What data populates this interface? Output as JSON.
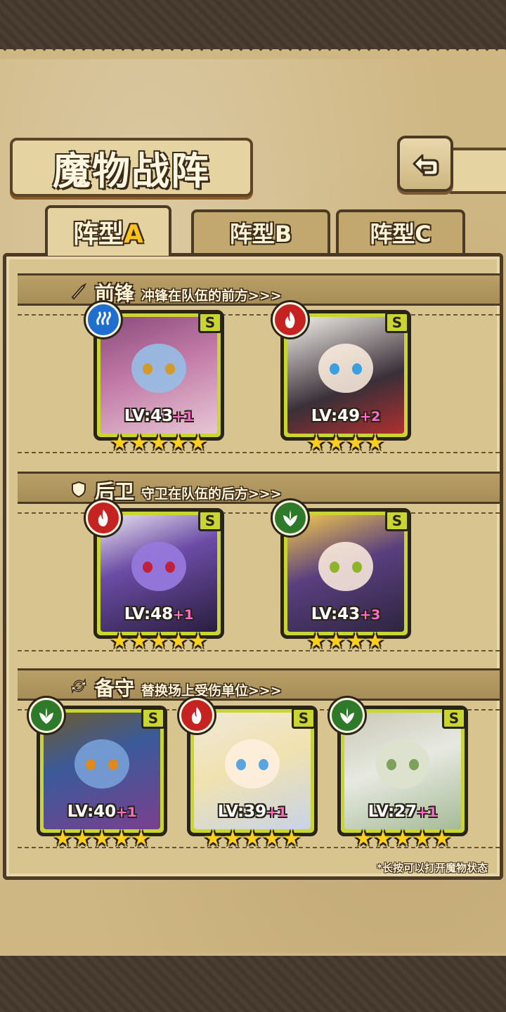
{
  "header": {
    "title": "魔物战阵"
  },
  "tabs": [
    {
      "prefix": "阵型",
      "letter": "A",
      "active": true
    },
    {
      "prefix": "阵型",
      "letter": "B",
      "active": false
    },
    {
      "prefix": "阵型",
      "letter": "C",
      "active": false
    }
  ],
  "sections": {
    "vanguard": {
      "name": "前锋",
      "desc": "冲锋在队伍的前方>>>"
    },
    "rearguard": {
      "name": "后卫",
      "desc": "守卫在队伍的后方>>>"
    },
    "reserve": {
      "name": "备守",
      "desc": "替换场上受伤单位>>>"
    }
  },
  "cards": {
    "vanguard": [
      {
        "element": "water",
        "rank": "S",
        "level_text": "LV:43",
        "bonus": "+1",
        "stars": 5
      },
      {
        "element": "fire",
        "rank": "S",
        "level_text": "LV:49",
        "bonus": "+2",
        "stars": 4
      }
    ],
    "rearguard": [
      {
        "element": "fire",
        "rank": "S",
        "level_text": "LV:48",
        "bonus": "+1",
        "stars": 5
      },
      {
        "element": "wood",
        "rank": "S",
        "level_text": "LV:43",
        "bonus": "+3",
        "stars": 4
      }
    ],
    "reserve": [
      {
        "element": "wood",
        "rank": "S",
        "level_text": "LV:40",
        "bonus": "+1",
        "stars": 5
      },
      {
        "element": "fire",
        "rank": "S",
        "level_text": "LV:39",
        "bonus": "+1",
        "stars": 5
      },
      {
        "element": "wood",
        "rank": "S",
        "level_text": "LV:27",
        "bonus": "+1",
        "stars": 5
      }
    ]
  },
  "hint": "*长按可以打开魔物状态",
  "colors": {
    "card_frame": "#c9d530",
    "water": "#1f6fd0",
    "fire": "#c62222",
    "wood": "#2f7a2a",
    "star": "#ffcf1d",
    "bonus": "#ff6bc8"
  }
}
